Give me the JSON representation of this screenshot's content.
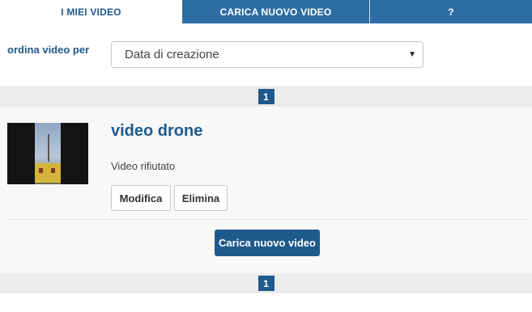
{
  "tabs": [
    {
      "label": "I MIEI VIDEO"
    },
    {
      "label": "CARICA NUOVO VIDEO"
    },
    {
      "label": "?"
    }
  ],
  "sort": {
    "label": "ordina video per",
    "selected": "Data di creazione"
  },
  "pagination": {
    "top_page": "1",
    "bottom_page": "1"
  },
  "videos": [
    {
      "title": "video drone",
      "status": "Video rifiutato",
      "edit_label": "Modifica",
      "delete_label": "Elimina"
    }
  ],
  "upload_button": "Carica nuovo video",
  "colors": {
    "accent": "#1f5a8c",
    "tab_bg": "#2e6da4",
    "pager_bg": "#ececec"
  }
}
